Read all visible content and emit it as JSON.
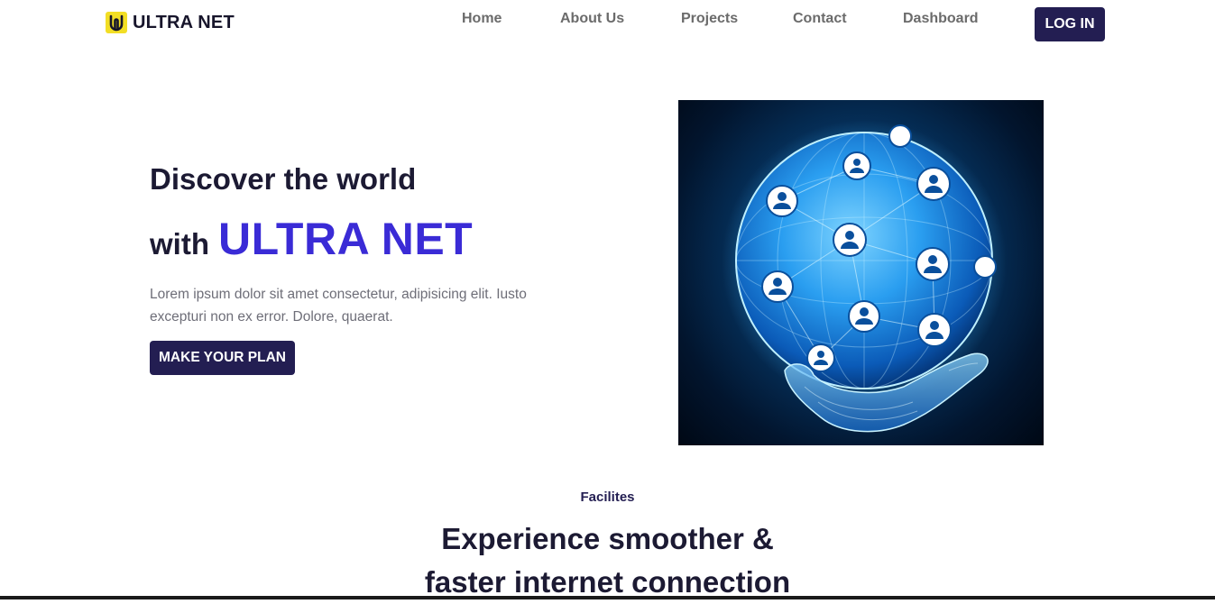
{
  "brand": {
    "name": "ULTRA NET",
    "logo_icon": "ultra-net-logo-icon",
    "logo_color": "#f2de25"
  },
  "nav": {
    "links": [
      {
        "label": "Home"
      },
      {
        "label": "About Us"
      },
      {
        "label": "Projects"
      },
      {
        "label": "Contact"
      },
      {
        "label": "Dashboard"
      }
    ],
    "login_label": "LOG IN"
  },
  "hero": {
    "title_line1": "Discover the world",
    "title_with": "with",
    "title_brand": "ULTRA NET",
    "description": "Lorem ipsum dolor sit amet consectetur, adipisicing elit. Iusto excepturi non ex error. Dolore, quaerat.",
    "cta_label": "MAKE YOUR PLAN",
    "image_icon": "globe-in-hand-network-illustration"
  },
  "facilities": {
    "eyebrow": "Facilites",
    "title_line1": "Experience smoother &",
    "title_line2": "faster internet connection"
  },
  "colors": {
    "primary_dark": "#231e52",
    "accent_purple": "#3a2bd6",
    "text_dark": "#1c1a33",
    "text_muted": "#6e6e78",
    "nav_gray": "#6b6b6b"
  }
}
